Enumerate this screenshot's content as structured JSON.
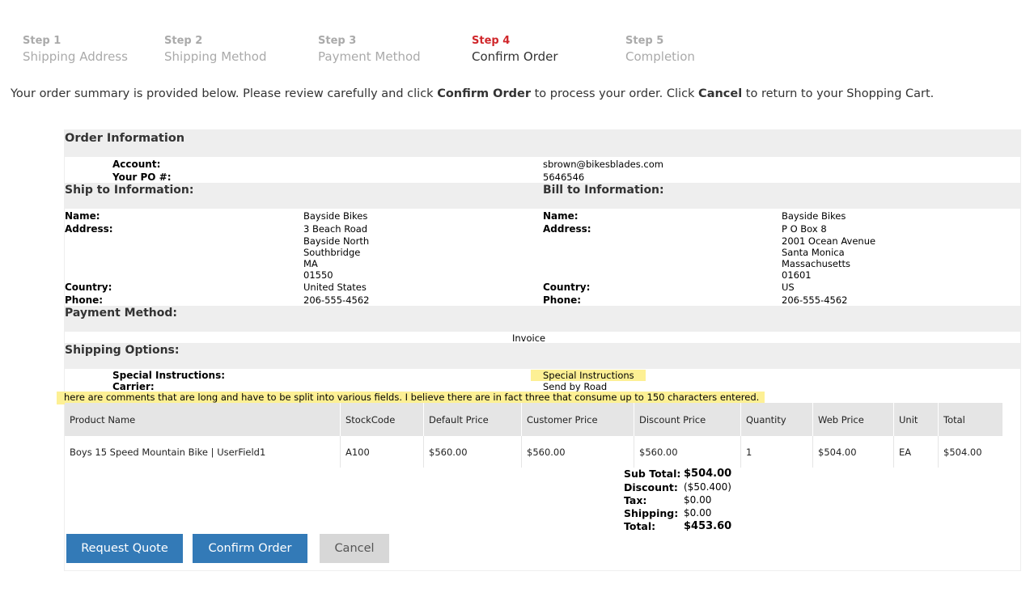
{
  "steps": [
    {
      "num": "Step 1",
      "name": "Shipping Address"
    },
    {
      "num": "Step 2",
      "name": "Shipping Method"
    },
    {
      "num": "Step 3",
      "name": "Payment Method"
    },
    {
      "num": "Step 4",
      "name": "Confirm Order"
    },
    {
      "num": "Step 5",
      "name": "Completion"
    }
  ],
  "intro": {
    "part1": "Your order summary is provided below.  Please review carefully and click ",
    "confirm": "Confirm Order",
    "part2": " to process your order.  Click ",
    "cancel": "Cancel",
    "part3": " to return to your Shopping Cart."
  },
  "order_info": {
    "heading": "Order Information",
    "account_label": "Account:",
    "account": "sbrown@bikesblades.com",
    "po_label": "Your PO #:",
    "po": "5646546"
  },
  "ship_to": {
    "heading": "Ship to Information:",
    "name_label": "Name:",
    "name": "Bayside Bikes",
    "address_label": "Address:",
    "address": [
      "3 Beach Road",
      "Bayside North",
      "Southbridge",
      "MA",
      "01550"
    ],
    "country_label": "Country:",
    "country": "United States",
    "phone_label": "Phone:",
    "phone": "206-555-4562"
  },
  "bill_to": {
    "heading": "Bill to Information:",
    "name_label": "Name:",
    "name": "Bayside Bikes",
    "address_label": "Address:",
    "address": [
      "P O Box 8",
      "2001 Ocean Avenue",
      "Santa Monica",
      "Massachusetts",
      "01601"
    ],
    "country_label": "Country:",
    "country": "US",
    "phone_label": "Phone:",
    "phone": "206-555-4562"
  },
  "payment": {
    "heading": "Payment Method:",
    "method": "Invoice"
  },
  "shipping": {
    "heading": "Shipping Options:",
    "special_label": "Special Instructions:",
    "special": "Special Instructions",
    "carrier_label": "Carrier:",
    "carrier": "Send by Road",
    "comments": "here are comments that are long and have to be split into various fields. I believe there are in fact three that consume up to 150 characters entered."
  },
  "table": {
    "headers": [
      "Product Name",
      "StockCode",
      "Default Price",
      "Customer Price",
      "Discount Price",
      "Quantity",
      "Web Price",
      "Unit",
      "Total"
    ],
    "rows": [
      [
        "Boys 15 Speed Mountain Bike | UserField1",
        "A100",
        "$560.00",
        "$560.00",
        "$560.00",
        "1",
        "$504.00",
        "EA",
        "$504.00"
      ]
    ]
  },
  "totals": {
    "subtotal_label": "Sub Total:",
    "subtotal": "$504.00",
    "discount_label": "Discount:",
    "discount": "($50.400)",
    "tax_label": "Tax:",
    "tax": "$0.00",
    "shipping_label": "Shipping:",
    "shipping": "$0.00",
    "total_label": "Total:",
    "total": "$453.60"
  },
  "buttons": {
    "request_quote": "Request Quote",
    "confirm_order": "Confirm Order",
    "cancel": "Cancel"
  },
  "colors": {
    "active_step": "#d0272b",
    "primary_button": "#337ab7",
    "highlight": "#fdf094"
  }
}
